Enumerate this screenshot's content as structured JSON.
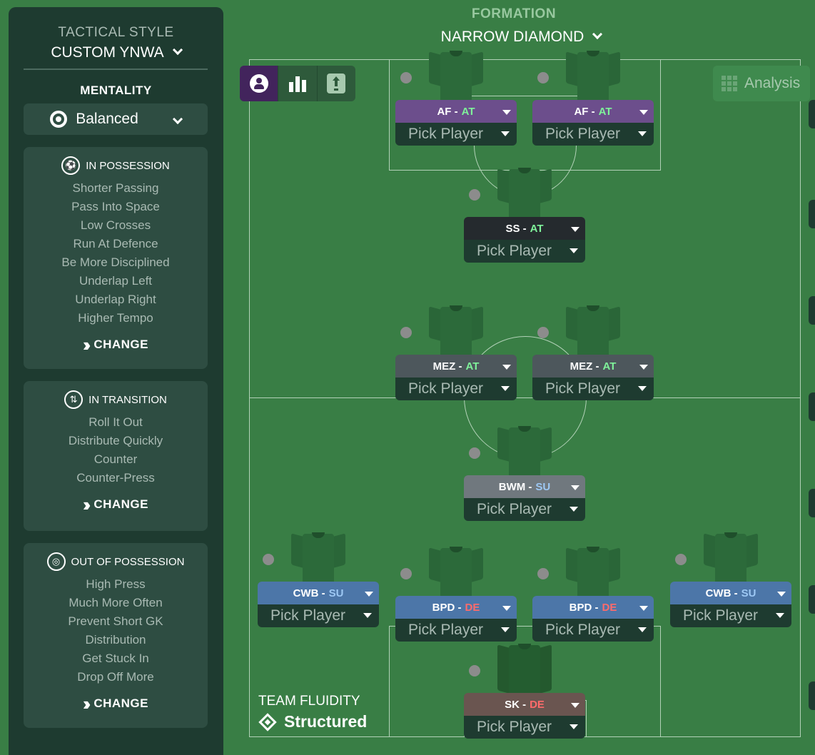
{
  "sidebar": {
    "tactical_style_label": "TACTICAL STYLE",
    "tactical_style_value": "CUSTOM YNWA",
    "mentality_label": "MENTALITY",
    "mentality_value": "Balanced",
    "in_possession": {
      "title": "IN POSSESSION",
      "items": [
        "Shorter Passing",
        "Pass Into Space",
        "Low Crosses",
        "Run At Defence",
        "Be More Disciplined",
        "Underlap Left",
        "Underlap Right",
        "Higher Tempo"
      ],
      "change_label": "CHANGE"
    },
    "in_transition": {
      "title": "IN TRANSITION",
      "items": [
        "Roll It Out",
        "Distribute Quickly",
        "Counter",
        "Counter-Press"
      ],
      "change_label": "CHANGE"
    },
    "out_of_possession": {
      "title": "OUT OF POSSESSION",
      "items": [
        "High Press",
        "Much More Often",
        "Prevent Short GK",
        "Distribution",
        "Get Stuck In",
        "Drop Off More"
      ],
      "change_label": "CHANGE"
    }
  },
  "header": {
    "formation_label": "FORMATION",
    "formation_value": "NARROW DIAMOND"
  },
  "toolbar": {
    "analysis_label": "Analysis"
  },
  "players": [
    {
      "role": "AF",
      "sep": "-",
      "duty": "AT",
      "pick": "Pick Player"
    },
    {
      "role": "AF",
      "sep": "-",
      "duty": "AT",
      "pick": "Pick Player"
    },
    {
      "role": "SS",
      "sep": "-",
      "duty": "AT",
      "pick": "Pick Player"
    },
    {
      "role": "MEZ",
      "sep": "-",
      "duty": "AT",
      "pick": "Pick Player"
    },
    {
      "role": "MEZ",
      "sep": "-",
      "duty": "AT",
      "pick": "Pick Player"
    },
    {
      "role": "BWM",
      "sep": "-",
      "duty": "SU",
      "pick": "Pick Player"
    },
    {
      "role": "CWB",
      "sep": "-",
      "duty": "SU",
      "pick": "Pick Player"
    },
    {
      "role": "BPD",
      "sep": "-",
      "duty": "DE",
      "pick": "Pick Player"
    },
    {
      "role": "BPD",
      "sep": "-",
      "duty": "DE",
      "pick": "Pick Player"
    },
    {
      "role": "CWB",
      "sep": "-",
      "duty": "SU",
      "pick": "Pick Player"
    },
    {
      "role": "SK",
      "sep": "-",
      "duty": "DE",
      "pick": "Pick Player"
    }
  ],
  "team_fluidity": {
    "label": "TEAM FLUIDITY",
    "value": "Structured"
  },
  "colors": {
    "pitch": "#397e45",
    "sidebar": "#1e3b30",
    "attack_duty": "#7ff29a",
    "support_duty": "#9dc8f4",
    "defend_duty": "#ff6b6b"
  }
}
